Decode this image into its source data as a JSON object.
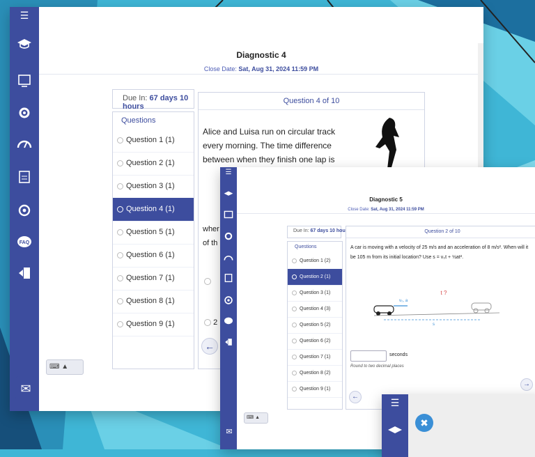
{
  "window1": {
    "title": "Diagnostic 4",
    "close_label": "Close Date:",
    "close_value": "Sat, Aug 31, 2024 11:59 PM",
    "due_label": "Due In:",
    "due_value": "67 days 10 hours",
    "questions_header": "Questions",
    "question_header": "Question 4 of 10",
    "question_text": "Alice and Luisa run on circular track every morning. The time difference between when they finish one lap is",
    "partial_left_a": "wher",
    "partial_left_b": "of th",
    "option_a": "",
    "option_b": "2",
    "questions": [
      {
        "label": "Question 1 (1)",
        "selected": false
      },
      {
        "label": "Question 2 (1)",
        "selected": false
      },
      {
        "label": "Question 3 (1)",
        "selected": false
      },
      {
        "label": "Question 4 (1)",
        "selected": true
      },
      {
        "label": "Question 5 (1)",
        "selected": false
      },
      {
        "label": "Question 6 (1)",
        "selected": false
      },
      {
        "label": "Question 7 (1)",
        "selected": false
      },
      {
        "label": "Question 8 (1)",
        "selected": false
      },
      {
        "label": "Question 9 (1)",
        "selected": false
      }
    ]
  },
  "window2": {
    "title": "Diagnostic 5",
    "close_label": "Close Date:",
    "close_value": "Sat, Aug 31, 2024 11:59 PM",
    "due_label": "Due In:",
    "due_value": "67 days 10 hours",
    "questions_header": "Questions",
    "question_header": "Question 2 of 10",
    "question_text": "A car is moving with a velocity of 25 m/s and an acceleration of 8 m/s². When will it be 105 m from its initial location? Use s = v₀t + ½at².",
    "diagram_label_t": "t ?",
    "diagram_label_v": "v₀, a",
    "diagram_label_s": "s",
    "answer_unit": "seconds",
    "answer_hint": "Round to two decimal places",
    "questions": [
      {
        "label": "Question 1 (2)",
        "selected": false
      },
      {
        "label": "Question 2 (1)",
        "selected": true
      },
      {
        "label": "Question 3 (1)",
        "selected": false
      },
      {
        "label": "Question 4 (3)",
        "selected": false
      },
      {
        "label": "Question 5 (2)",
        "selected": false
      },
      {
        "label": "Question 6 (2)",
        "selected": false
      },
      {
        "label": "Question 7 (1)",
        "selected": false
      },
      {
        "label": "Question 8 (2)",
        "selected": false
      },
      {
        "label": "Question 9 (1)",
        "selected": false
      }
    ]
  },
  "icons": {
    "menu": "☰",
    "back_arrow": "←",
    "next_arrow": "→",
    "mail": "✉",
    "keyboard_caret": "▲"
  },
  "colors": {
    "sidebar": "#3d4d9e",
    "selected": "#3d4d9e",
    "accent_red": "#d64545",
    "background": "#3fb6d6"
  }
}
